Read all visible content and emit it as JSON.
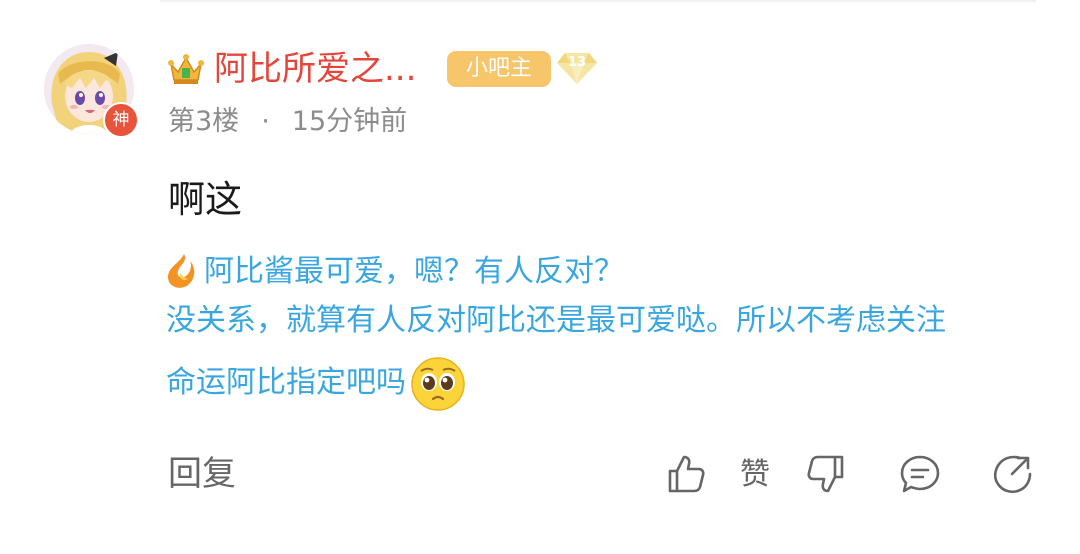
{
  "post": {
    "username": "阿比所爱之...",
    "role_badge": "小吧主",
    "level": "13",
    "floor": "第3楼",
    "separator": "·",
    "time": "15分钟前",
    "content": "啊这",
    "avatar_badge": "神"
  },
  "signature": {
    "line1": "阿比酱最可爱，嗯？有人反对？",
    "line2": "没关系，就算有人反对阿比还是最可爱哒。所以不考虑关注",
    "line3": "命运阿比指定吧吗"
  },
  "actions": {
    "reply_label": "回复",
    "like_label": "赞"
  },
  "colors": {
    "username": "#e3473c",
    "badge": "#f7c66a",
    "signature": "#3aa6e0",
    "meta": "#8c8c8c",
    "action": "#666666"
  },
  "icons": [
    "crown-icon",
    "level-diamond-icon",
    "flame-icon",
    "pleading-emoji-icon",
    "thumbs-up-icon",
    "thumbs-down-icon",
    "comment-icon",
    "share-icon"
  ]
}
